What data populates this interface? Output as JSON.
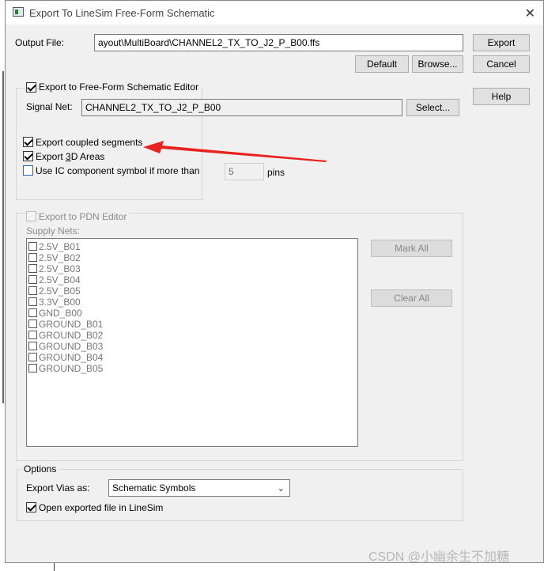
{
  "window": {
    "title": "Export To LineSim Free-Form Schematic"
  },
  "output": {
    "label": "Output File:",
    "value": "ayout\\MultiBoard\\CHANNEL2_TX_TO_J2_P_B00.ffs"
  },
  "buttons": {
    "export": "Export",
    "cancel": "Cancel",
    "help": "Help",
    "default": "Default",
    "browse": "Browse...",
    "select": "Select...",
    "mark_all": "Mark All",
    "clear_all": "Clear All"
  },
  "ffs": {
    "group_label": "Export to Free-Form Schematic Editor",
    "checked": true,
    "signal_net_label": "Signal Net:",
    "signal_net_value": "CHANNEL2_TX_TO_J2_P_B00",
    "coupled": {
      "label": "Export coupled segments",
      "checked": true
    },
    "areas3d": {
      "label_prefix": "Export ",
      "label_accel": "3",
      "label_suffix": "D Areas",
      "checked": true
    },
    "ic_symbol": {
      "label": "Use IC component symbol if more than",
      "checked": false,
      "value": "5",
      "unit": "pins"
    }
  },
  "pdn": {
    "group_label": "Export to PDN Editor",
    "supply_nets_label": "Supply Nets:",
    "nets": [
      "2.5V_B01",
      "2.5V_B02",
      "2.5V_B03",
      "2.5V_B04",
      "2.5V_B05",
      "3.3V_B00",
      "GND_B00",
      "GROUND_B01",
      "GROUND_B02",
      "GROUND_B03",
      "GROUND_B04",
      "GROUND_B05"
    ]
  },
  "options": {
    "group_label": "Options",
    "vias_label": "Export Vias as:",
    "vias_value": "Schematic Symbols",
    "open_label": "Open exported file in LineSim",
    "open_checked": true
  },
  "annotation": {
    "arrow_color": "#e8231f"
  },
  "watermark": "CSDN @小幽余生不加糖"
}
